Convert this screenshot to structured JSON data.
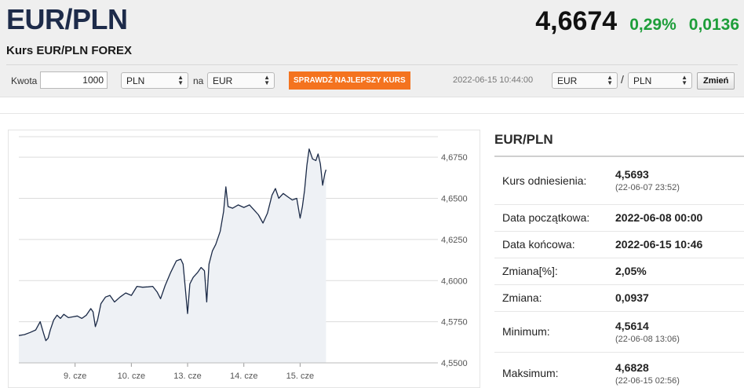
{
  "header": {
    "pair": "EUR/PLN",
    "subtitle": "Kurs EUR/PLN FOREX",
    "price": "4,6674",
    "change_pct": "0,29%",
    "change_abs": "0,0136",
    "change_color": "#1e9e3a"
  },
  "converter": {
    "amount_label": "Kwota",
    "amount_value": "1000",
    "from_currency": "PLN",
    "to_label": "na",
    "to_currency": "EUR",
    "check_button": "SPRAWDŹ NAJLEPSZY KURS",
    "timestamp": "2022-06-15 10:44:00",
    "pair_base": "EUR",
    "pair_sep": "/",
    "pair_quote": "PLN",
    "swap_button": "Zmień",
    "button_color": "#f4731f"
  },
  "stats": {
    "title": "EUR/PLN",
    "rows": [
      {
        "label": "Kurs odniesienia:",
        "value": "4,5693",
        "sub": "(22-06-07 23:52)"
      },
      {
        "label": "Data początkowa:",
        "value": "2022-06-08 00:00",
        "sub": ""
      },
      {
        "label": "Data końcowa:",
        "value": "2022-06-15 10:46",
        "sub": ""
      },
      {
        "label": "Zmiana[%]:",
        "value": "2,05%",
        "sub": ""
      },
      {
        "label": "Zmiana:",
        "value": "0,0937",
        "sub": ""
      },
      {
        "label": "Minimum:",
        "value": "4,5614",
        "sub": "(22-06-08 13:06)"
      },
      {
        "label": "Maksimum:",
        "value": "4,6828",
        "sub": "(22-06-15 02:56)"
      }
    ]
  },
  "chart_data": {
    "type": "area",
    "title": "",
    "xlabel": "",
    "ylabel": "",
    "ylim": [
      4.55,
      4.6875
    ],
    "xlim": [
      0,
      7.45
    ],
    "grid": true,
    "x_ticks": [
      {
        "x": 1,
        "label": "9. cze"
      },
      {
        "x": 2,
        "label": "10. cze"
      },
      {
        "x": 3,
        "label": "13. cze"
      },
      {
        "x": 4,
        "label": "14. cze"
      },
      {
        "x": 5,
        "label": "15. cze"
      }
    ],
    "y_ticks": [
      {
        "v": 4.55,
        "label": "4,5500"
      },
      {
        "v": 4.575,
        "label": "4,5750"
      },
      {
        "v": 4.6,
        "label": "4,6000"
      },
      {
        "v": 4.625,
        "label": "4,6250"
      },
      {
        "v": 4.65,
        "label": "4,6500"
      },
      {
        "v": 4.675,
        "label": "4,6750"
      }
    ],
    "series": [
      {
        "color": "#1b2a47",
        "fill": "#eef1f5",
        "points": [
          [
            0.0,
            4.5666
          ],
          [
            0.1,
            4.5672
          ],
          [
            0.2,
            4.5685
          ],
          [
            0.3,
            4.57
          ],
          [
            0.38,
            4.575
          ],
          [
            0.44,
            4.568
          ],
          [
            0.48,
            4.5635
          ],
          [
            0.52,
            4.565
          ],
          [
            0.56,
            4.57
          ],
          [
            0.62,
            4.576
          ],
          [
            0.68,
            4.579
          ],
          [
            0.74,
            4.577
          ],
          [
            0.8,
            4.5795
          ],
          [
            0.88,
            4.5775
          ],
          [
            0.96,
            4.578
          ],
          [
            1.04,
            4.5785
          ],
          [
            1.12,
            4.577
          ],
          [
            1.2,
            4.579
          ],
          [
            1.28,
            4.583
          ],
          [
            1.32,
            4.581
          ],
          [
            1.36,
            4.572
          ],
          [
            1.4,
            4.576
          ],
          [
            1.46,
            4.586
          ],
          [
            1.54,
            4.59
          ],
          [
            1.62,
            4.591
          ],
          [
            1.7,
            4.587
          ],
          [
            1.8,
            4.59
          ],
          [
            1.9,
            4.5925
          ],
          [
            2.0,
            4.591
          ],
          [
            2.1,
            4.5965
          ],
          [
            2.2,
            4.596
          ],
          [
            2.3,
            4.5962
          ],
          [
            2.38,
            4.5965
          ],
          [
            2.46,
            4.593
          ],
          [
            2.52,
            4.589
          ],
          [
            2.6,
            4.597
          ],
          [
            2.7,
            4.605
          ],
          [
            2.8,
            4.612
          ],
          [
            2.88,
            4.613
          ],
          [
            2.92,
            4.61
          ],
          [
            2.96,
            4.595
          ],
          [
            3.0,
            4.58
          ],
          [
            3.04,
            4.598
          ],
          [
            3.1,
            4.602
          ],
          [
            3.18,
            4.605
          ],
          [
            3.24,
            4.608
          ],
          [
            3.3,
            4.606
          ],
          [
            3.34,
            4.587
          ],
          [
            3.38,
            4.61
          ],
          [
            3.44,
            4.618
          ],
          [
            3.5,
            4.622
          ],
          [
            3.58,
            4.63
          ],
          [
            3.64,
            4.642
          ],
          [
            3.68,
            4.657
          ],
          [
            3.72,
            4.645
          ],
          [
            3.8,
            4.644
          ],
          [
            3.9,
            4.646
          ],
          [
            4.0,
            4.6445
          ],
          [
            4.1,
            4.646
          ],
          [
            4.18,
            4.643
          ],
          [
            4.26,
            4.64
          ],
          [
            4.34,
            4.635
          ],
          [
            4.42,
            4.641
          ],
          [
            4.5,
            4.652
          ],
          [
            4.56,
            4.656
          ],
          [
            4.62,
            4.65
          ],
          [
            4.7,
            4.653
          ],
          [
            4.78,
            4.651
          ],
          [
            4.86,
            4.649
          ],
          [
            4.94,
            4.65
          ],
          [
            5.0,
            4.638
          ],
          [
            5.04,
            4.645
          ],
          [
            5.08,
            4.655
          ],
          [
            5.12,
            4.67
          ],
          [
            5.16,
            4.68
          ],
          [
            5.22,
            4.674
          ],
          [
            5.28,
            4.673
          ],
          [
            5.32,
            4.677
          ],
          [
            5.36,
            4.671
          ],
          [
            5.4,
            4.658
          ],
          [
            5.44,
            4.665
          ],
          [
            5.46,
            4.6674
          ]
        ]
      }
    ]
  }
}
